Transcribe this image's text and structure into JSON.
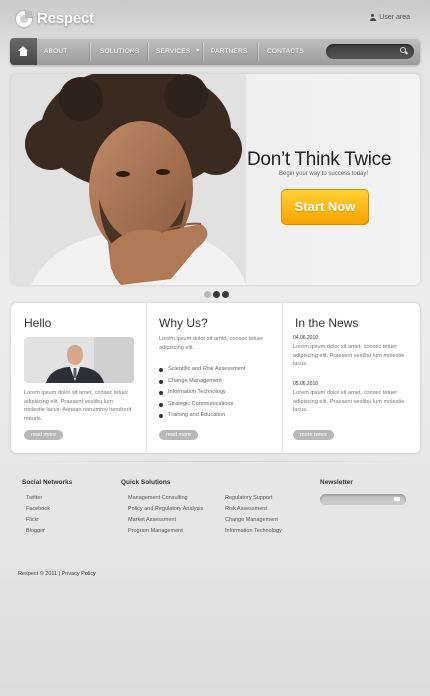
{
  "header": {
    "logo_text": "Respect",
    "user_area": "User area"
  },
  "nav": {
    "items": [
      "ABOUT",
      "SOLUTIONS",
      "SERVICES",
      "PARTNERS",
      "CONTACTS"
    ],
    "search_placeholder": ""
  },
  "hero": {
    "title": "Don’t Think Twice",
    "subtitle": "Begin your way to success today!",
    "cta_label": "Start Now",
    "slide_count": 3,
    "active_slide": 2
  },
  "panels": {
    "hello": {
      "title": "Hello",
      "text": "Lorem ipsum dolor sit amet, consec tetuer adipiscing elit. Praesent vestibu lum molestie lacus. Aenean nonummy hendrerit mauris.",
      "button": "read more"
    },
    "why_us": {
      "title": "Why Us?",
      "intro": "Lorem ipsum dolor sit amet, consec tetuer adipiscing elit.",
      "bullets": [
        "Scientific and Risk Assessment",
        "Change Management",
        "Information Technology",
        "Strategic Communications",
        "Training and Education"
      ],
      "button": "read more"
    },
    "news": {
      "title": "In the News",
      "items": [
        {
          "date": "04.06.2010",
          "text": "Lorem ipsum dolor sit amet, consec tetuer adipiscing elit. Praesent vestibu lum molestie lacus."
        },
        {
          "date": "05.06.2010",
          "text": "Lorem ipsum dolor sit amet, consec tetuer adipiscing elit. Praesent vestibu lum molestie lacus."
        }
      ],
      "button": "more news"
    }
  },
  "footer": {
    "social_title": "Social Networks",
    "social_links": [
      "Twitter",
      "Facebook",
      "Flickr",
      "Blogger"
    ],
    "solutions_title": "Quick Solutions",
    "solutions_col1": [
      "Management Consulting",
      "Policy and Regulatory Analysis",
      "Market Assessment",
      "Program Management"
    ],
    "solutions_col2": [
      "Regulatory Support",
      "Risk Assessment",
      "Change Management",
      "Information Technology"
    ],
    "newsletter_title": "Newsletter",
    "copyright": "Respect © 2011 | Privacy Policy"
  },
  "colors": {
    "accent_orange": "#f7a300",
    "nav_gray": "#a8a8a8",
    "home_dark": "#4f4f4f"
  }
}
